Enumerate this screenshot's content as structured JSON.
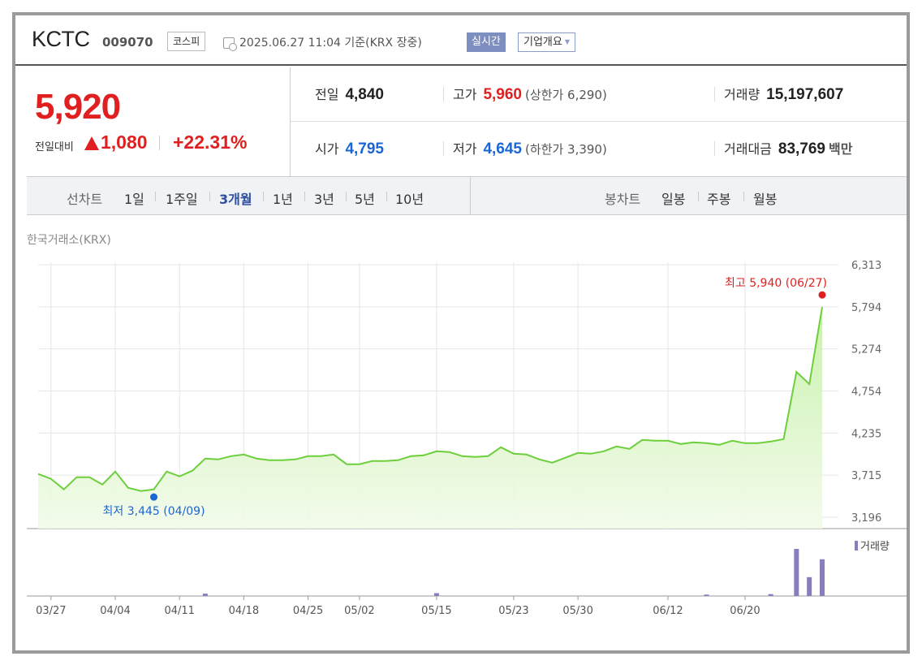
{
  "header": {
    "name": "KCTC",
    "code": "009070",
    "market": "코스피",
    "datetime": "2025.06.27 11:04 기준(KRX 장중)",
    "realtime": "실시간",
    "overview": "기업개요"
  },
  "quote": {
    "price": "5,920",
    "change_label": "전일대비",
    "change_value": "1,080",
    "change_rate": "+22.31%",
    "prev_close_label": "전일",
    "prev_close": "4,840",
    "open_label": "시가",
    "open": "4,795",
    "high_label": "고가",
    "high": "5,960",
    "upper_limit": "(상한가 6,290)",
    "low_label": "저가",
    "low": "4,645",
    "lower_limit": "(하한가 3,390)",
    "volume_label": "거래량",
    "volume": "15,197,607",
    "amount_label": "거래대금",
    "amount": "83,769",
    "amount_unit": "백만"
  },
  "tabs": {
    "line_chart_label": "선차트",
    "periods": [
      "1일",
      "1주일",
      "3개월",
      "1년",
      "3년",
      "5년",
      "10년"
    ],
    "active_period": "3개월",
    "candle_chart_label": "봉차트",
    "candle_periods": [
      "일봉",
      "주봉",
      "월봉"
    ]
  },
  "chart_source": "한국거래소(KRX)",
  "colors": {
    "up": "#e02020",
    "down": "#1a66d6",
    "line": "#6ccf3b",
    "volume": "#8b7cc0"
  },
  "chart_data": {
    "type": "area",
    "x_tick_labels": [
      "03/27",
      "04/04",
      "04/11",
      "04/18",
      "04/25",
      "05/02",
      "05/15",
      "05/23",
      "05/30",
      "06/12",
      "06/20"
    ],
    "y_tick_labels": [
      "6,313",
      "5,794",
      "5,274",
      "4,754",
      "4,235",
      "3,715",
      "3,196"
    ],
    "ylim": [
      3196,
      6313
    ],
    "grid": true,
    "series": [
      {
        "values": [
          3730,
          3670,
          3540,
          3690,
          3690,
          3600,
          3760,
          3560,
          3520,
          3540,
          3760,
          3700,
          3770,
          3920,
          3910,
          3950,
          3970,
          3920,
          3900,
          3900,
          3910,
          3950,
          3950,
          3970,
          3850,
          3850,
          3890,
          3890,
          3900,
          3950,
          3960,
          4010,
          4000,
          3950,
          3940,
          3950,
          4060,
          3980,
          3970,
          3910,
          3870,
          3930,
          3990,
          3980,
          4010,
          4070,
          4040,
          4150,
          4140,
          4140,
          4100,
          4120,
          4110,
          4090,
          4140,
          4110,
          4110,
          4130,
          4160,
          4990,
          4840,
          5790
        ]
      },
      {
        "name": "거래량",
        "values": [
          0,
          0,
          0,
          0,
          0,
          0,
          0,
          0,
          0,
          0,
          0,
          0,
          0,
          0.05,
          0,
          0,
          0,
          0,
          0,
          0,
          0,
          0,
          0,
          0,
          0,
          0,
          0,
          0,
          0,
          0,
          0,
          0.06,
          0,
          0,
          0,
          0,
          0,
          0,
          0,
          0,
          0,
          0,
          0,
          0,
          0,
          0,
          0,
          0,
          0,
          0,
          0,
          0,
          0.03,
          0,
          0,
          0,
          0,
          0.04,
          0,
          1.0,
          0.4,
          0.78
        ]
      }
    ],
    "annotations": {
      "high_label": "최고 5,940 (06/27)",
      "low_label": "최저 3,445 (04/09)"
    }
  }
}
